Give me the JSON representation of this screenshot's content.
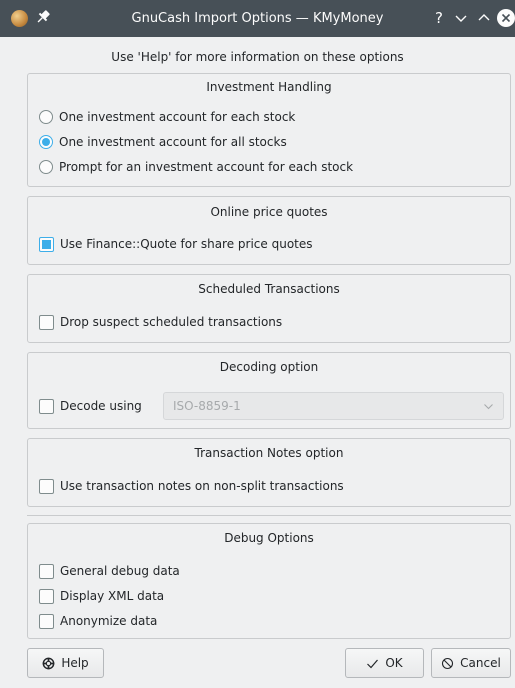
{
  "window": {
    "title": "GnuCash Import Options — KMyMoney",
    "help_glyph": "?"
  },
  "hint": "Use 'Help' for more information on these options",
  "investment": {
    "title": "Investment Handling",
    "options": [
      {
        "label": "One investment account for each stock",
        "checked": false
      },
      {
        "label": "One investment account for all stocks",
        "checked": true
      },
      {
        "label": "Prompt for an investment account for each stock",
        "checked": false
      }
    ]
  },
  "quotes": {
    "title": "Online price quotes",
    "option": {
      "label": "Use Finance::Quote for share price quotes",
      "checked": true
    }
  },
  "scheduled": {
    "title": "Scheduled Transactions",
    "option": {
      "label": "Drop suspect scheduled transactions",
      "checked": false
    }
  },
  "decoding": {
    "title": "Decoding option",
    "option": {
      "label": "Decode using",
      "checked": false
    },
    "combo_value": "ISO-8859-1"
  },
  "notes": {
    "title": "Transaction Notes option",
    "option": {
      "label": "Use transaction notes on non-split transactions",
      "checked": false
    }
  },
  "debug": {
    "title": "Debug Options",
    "options": [
      {
        "label": "General debug data",
        "checked": false
      },
      {
        "label": "Display XML data",
        "checked": false
      },
      {
        "label": "Anonymize data",
        "checked": false
      }
    ]
  },
  "buttons": {
    "help": "Help",
    "ok": "OK",
    "cancel": "Cancel"
  },
  "colors": {
    "titlebar": "#475057",
    "accent": "#3daee9",
    "window_bg": "#eff0f1"
  }
}
